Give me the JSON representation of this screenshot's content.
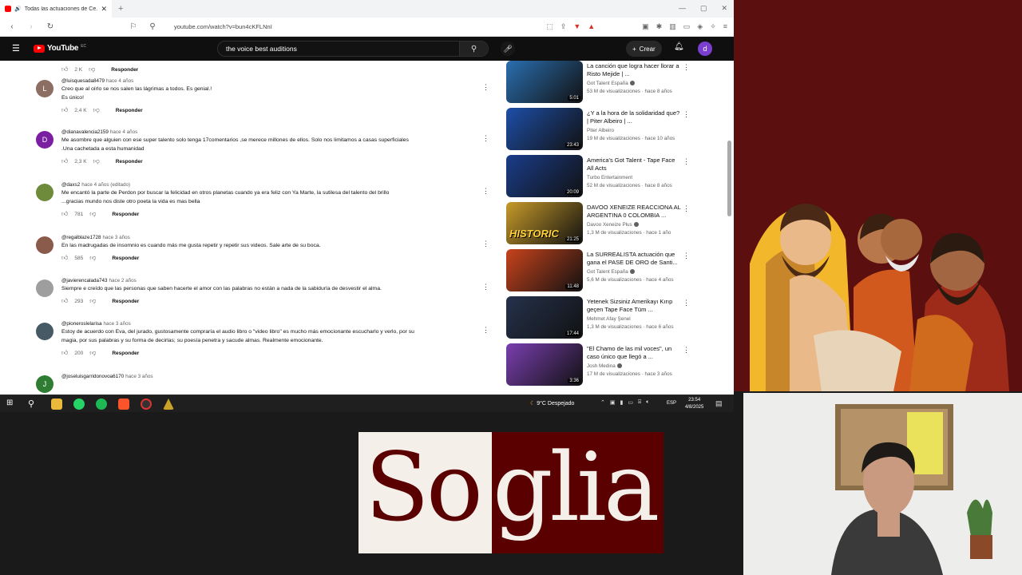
{
  "browser": {
    "tab_title": "Todas las actuaciones de Ce...",
    "url": "youtube.com/watch?v=bun4cKFLNnI"
  },
  "youtube": {
    "logo_text": "YouTube",
    "country_code": "EC",
    "search_value": "the voice best auditions",
    "create_label": "Crear",
    "user_initial": "d"
  },
  "comments": {
    "top_likes": "2 K",
    "reply_label": "Responder",
    "items": [
      {
        "initial": "L",
        "color": "#8d6e63",
        "handle": "@luisquesada8479",
        "time": "hace 4 años",
        "lines": [
          "Creo que al oírlo se nos salen las lágrimas a todos. Es genial.!",
          "Es único!"
        ],
        "likes": "2,4 K"
      },
      {
        "initial": "D",
        "color": "#7b1fa2",
        "handle": "@dianavalencia2159",
        "time": "hace 4 años",
        "lines": [
          "Me asombre que alguien con ese super talento solo tenga 17comentarios ,se merece millones de ellos. Solo nos limitamos a casas superficiales",
          ".Una cachetada a esta humanidad"
        ],
        "likes": "2,3 K"
      },
      {
        "initial": "",
        "color": "#6d8b3a",
        "handle": "@daxs2",
        "time": "hace 4 años (editado)",
        "lines": [
          "Me encantó la parte de Perdon por buscar la felicidad en otros planetas cuando ya era feliz con Ya Marte, la sutilesa del talento del brillo",
          "...gracias mundo nos diste otro poeta la vida es mas bella"
        ],
        "likes": "781"
      },
      {
        "initial": "",
        "color": "#8a5a4a",
        "handle": "@regalblaze1728",
        "time": "hace 3 años",
        "lines": [
          "En las madrugadas de insomnio es cuando más me gusta repetir y repetir sus videos. Sale arte de su boca."
        ],
        "likes": "585"
      },
      {
        "initial": "",
        "color": "#9e9e9e",
        "handle": "@javierencalada743",
        "time": "hace 2 años",
        "lines": [
          "Siempre e creído que las personas que saben hacerte el amor con las palabras no están a nada de la sabiduría de desvestir el alma."
        ],
        "likes": "293"
      },
      {
        "initial": "",
        "color": "#455a64",
        "handle": "@pioneroslelarisa",
        "time": "hace 3 años",
        "lines": [
          "Estoy de acuerdo con Eva, del jurado, gustosamente compraría el audio libro o \"video libro\" es mucho más emocionante escucharlo y verlo, por su",
          "magia, por sus palabras y su forma de decirlas; su poesía penetra y sacude almas. Realmente emocionante."
        ],
        "likes": "200"
      },
      {
        "initial": "J",
        "color": "#2e7d32",
        "handle": "@joseluisgarridonovoa6170",
        "time": "hace 3 años",
        "lines": [],
        "likes": ""
      }
    ]
  },
  "related": [
    {
      "title": "La canción que logra hacer llorar a Risto Mejide | ...",
      "channel": "Got Talent España",
      "verified": true,
      "meta": "53 M de visualizaciones · hace 8 años",
      "duration": "5:01",
      "thumb": "#2a6fb0"
    },
    {
      "title": "¿Y a la hora de la solidaridad que? | Piter Albeiro | ...",
      "channel": "Piter Albeiro",
      "verified": false,
      "meta": "19 M de visualizaciones · hace 10 años",
      "duration": "23:43",
      "thumb": "#1d4fa8"
    },
    {
      "title": "America's Got Talent - Tape Face All Acts",
      "channel": "Turbo Entertainment",
      "verified": false,
      "meta": "52 M de visualizaciones · hace 8 años",
      "duration": "20:09",
      "thumb": "#1a3d8a"
    },
    {
      "title": "DAVOO XENEIZE REACCIONA AL ARGENTINA 0 COLOMBIA ...",
      "channel": "Davoo Xeneize Plus",
      "verified": true,
      "meta": "1,3 M de visualizaciones · hace 1 año",
      "duration": "21:25",
      "thumb": "#c79a2a",
      "overlay": "HISTORIC"
    },
    {
      "title": "La SURREALISTA actuación que gana el PASE DE ORO de Santi...",
      "channel": "Got Talent España",
      "verified": true,
      "meta": "5,6 M de visualizaciones · hace 4 años",
      "duration": "11:48",
      "thumb": "#c8431c"
    },
    {
      "title": "Yetenek Sizsiniz Amerikayı Kırıp geçen Tape Face Tüm ...",
      "channel": "Mehmet Afay Şenel",
      "verified": false,
      "meta": "1,3 M de visualizaciones · hace 6 años",
      "duration": "17:44",
      "thumb": "#25324d"
    },
    {
      "title": "\"El Chamo de las mil voces\", un caso único que llegó a ...",
      "channel": "Josh Medina",
      "verified": true,
      "meta": "17 M de visualizaciones · hace 3 años",
      "duration": "3:36",
      "thumb": "#7a3fb0"
    }
  ],
  "taskbar": {
    "weather": "9°C Despejado",
    "lang": "ESP",
    "time": "23:54",
    "date": "4/8/2025"
  },
  "overlay_logo": {
    "text_left": "So",
    "text_right": "glia"
  }
}
